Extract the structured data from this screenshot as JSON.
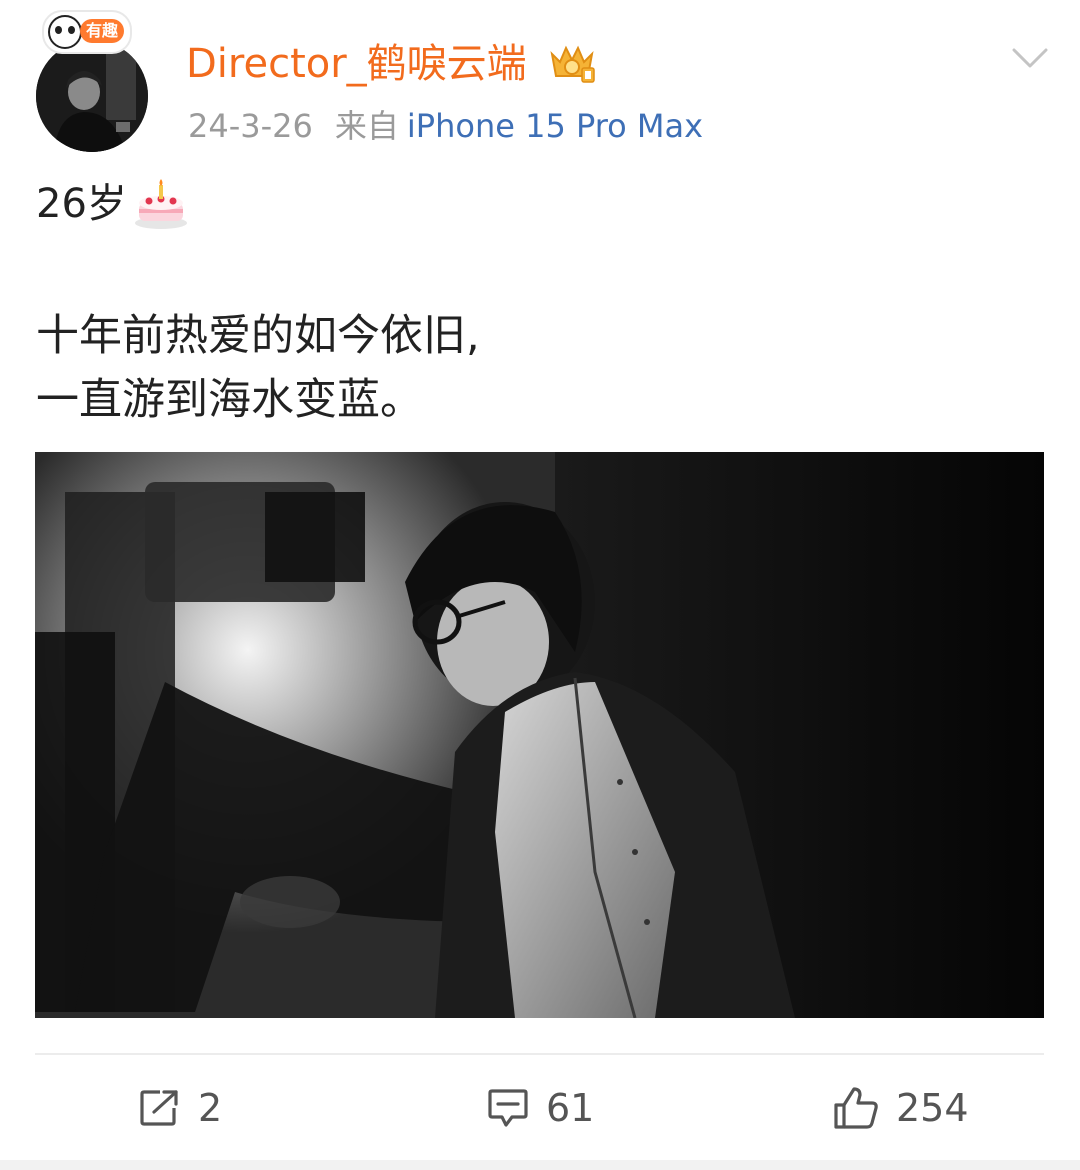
{
  "user": {
    "name": "Director_鹤唳云端",
    "badge_text": "有趣",
    "vip_icon": "gold-crown-badge-icon"
  },
  "meta": {
    "date": "24-3-26",
    "from_label": "来自",
    "device": "iPhone 15 Pro Max"
  },
  "post": {
    "line1": "26岁",
    "emoji": "birthday-cake-icon",
    "line2": "十年前热爱的如今依旧,",
    "line3": "一直游到海水变蓝。"
  },
  "actions": {
    "repost_count": "2",
    "comment_count": "61",
    "like_count": "254"
  },
  "colors": {
    "username": "#f26b1d",
    "device_link": "#3e6fb6",
    "meta_gray": "#9a9a9a"
  }
}
